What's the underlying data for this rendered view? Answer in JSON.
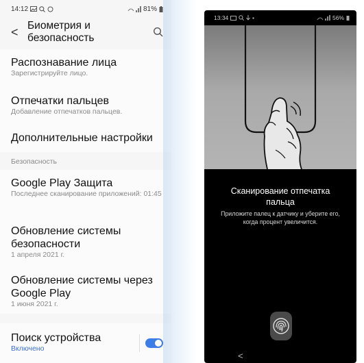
{
  "left": {
    "status": {
      "time": "14:12",
      "battery": "81%"
    },
    "header": {
      "back": "<",
      "title": "Биометрия и безопасность"
    },
    "biometrics": [
      {
        "title": "Распознавание лица",
        "subtitle": "Зарегистрируйте лицо."
      },
      {
        "title": "Отпечатки пальцев",
        "subtitle": "Добавление отпечатков пальцев."
      },
      {
        "title": "Дополнительные настройки",
        "subtitle": ""
      }
    ],
    "security_label": "Безопасность",
    "security": [
      {
        "title": "Google Play Защита",
        "subtitle": "Последнее сканирование приложений: 01:45"
      },
      {
        "title_line1": "Обновление системы",
        "title_line2": "безопасности",
        "subtitle": "1 апреля 2021 г."
      },
      {
        "title_line1": "Обновление системы через",
        "title_line2": "Google Play",
        "subtitle": "1 июня 2021 г."
      }
    ],
    "find_device": {
      "title": "Поиск устройства",
      "status": "Включено",
      "enabled": true
    }
  },
  "right": {
    "status": {
      "time": "13:34",
      "battery": "56%"
    },
    "title_line1": "Сканирование отпечатка",
    "title_line2": "пальца",
    "hint_line1": "Приложите палец к датчику и уберите его,",
    "hint_line2": "когда процент увеличится.",
    "nav_back": "<"
  },
  "colors": {
    "accent": "#3d7de8",
    "link": "#3a6fd0",
    "scan_bg": "#000000"
  },
  "icons": [
    "search-icon",
    "fingerprint-icon",
    "finger-press-illustration"
  ]
}
